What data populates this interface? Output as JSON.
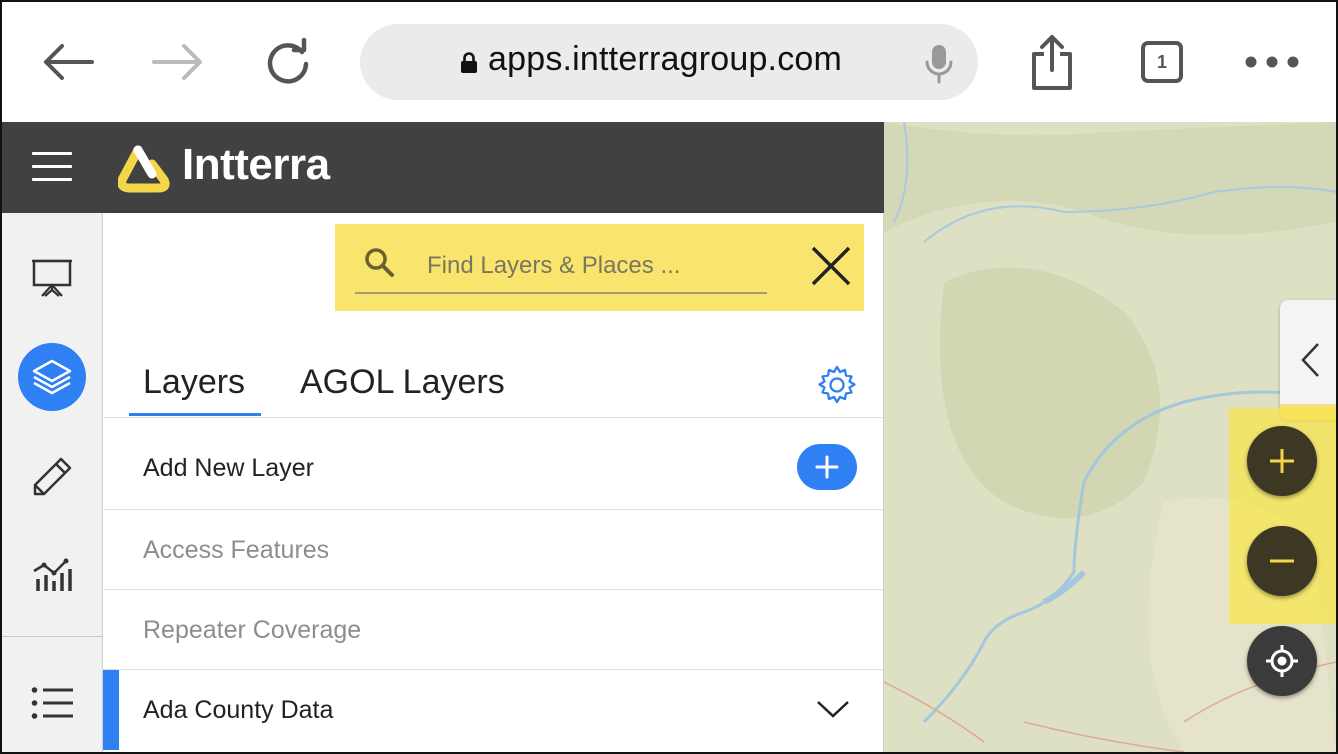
{
  "browser": {
    "url": "apps.intterragroup.com",
    "tab_count": "1"
  },
  "app": {
    "brand": "Intterra",
    "accent_color": "#2f80f2",
    "highlight_color": "#f9e56e"
  },
  "sidebar": {
    "items": [
      {
        "icon": "presentation-icon"
      },
      {
        "icon": "layers-icon",
        "active": true
      },
      {
        "icon": "pencil-icon"
      },
      {
        "icon": "analytics-icon"
      },
      {
        "icon": "list-icon"
      }
    ]
  },
  "search": {
    "placeholder": "Find Layers & Places ..."
  },
  "tabs": [
    {
      "label": "Layers",
      "active": true
    },
    {
      "label": "AGOL Layers",
      "active": false
    }
  ],
  "rows": [
    {
      "label": "Add New Layer"
    },
    {
      "label": "Access Features"
    },
    {
      "label": "Repeater Coverage"
    },
    {
      "label": "Ada County Data"
    }
  ]
}
